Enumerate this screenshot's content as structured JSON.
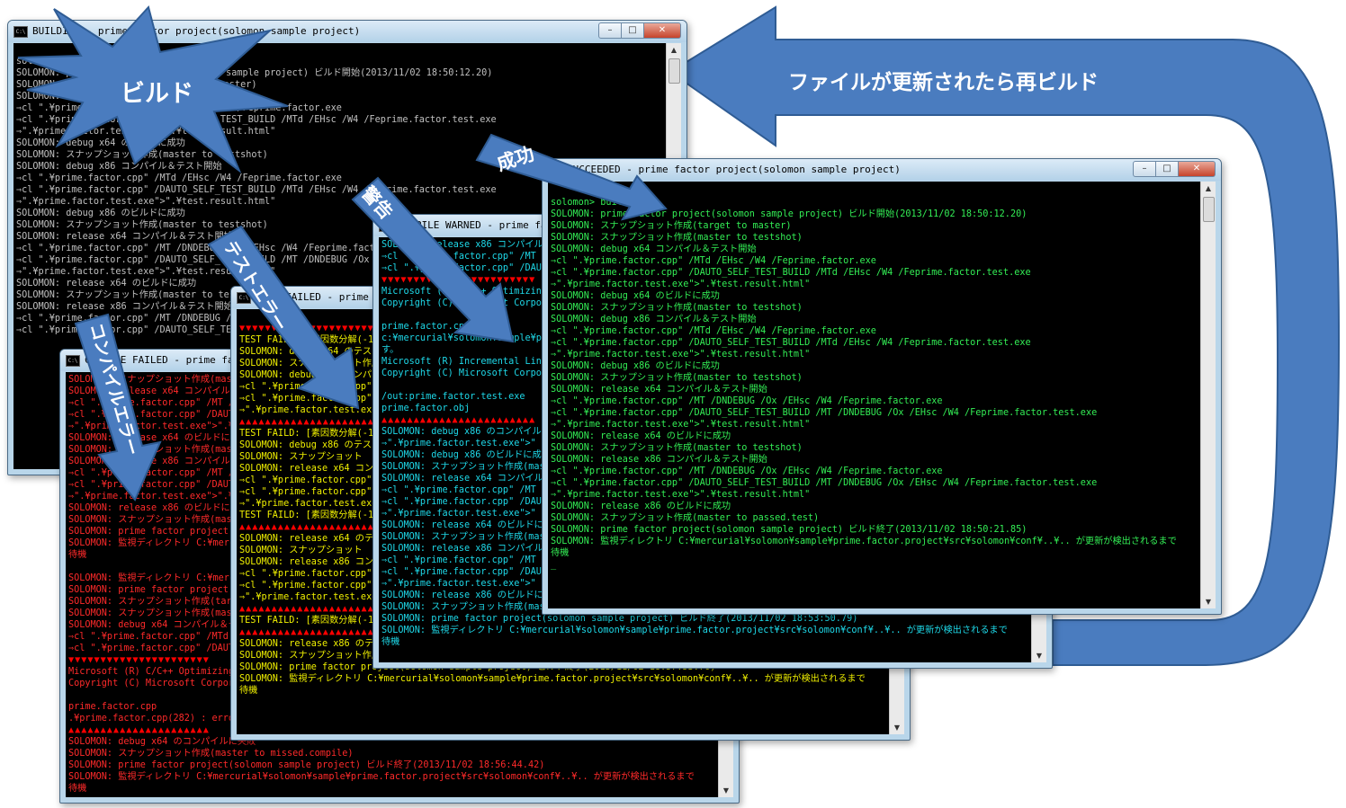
{
  "windows": {
    "building": {
      "title": "BUILDING - prime factor project(solomon sample project)",
      "lines": [
        "solomon> cd \\out",
        "SOLOMON: prime factor project(solomon sample project) ビルド開始(2013/11/02 18:50:12.20)",
        "SOLOMON: スナップショット作成(target to master)",
        "SOLOMON: debug x64 コンパイル＆テスト開始",
        "⇒cl \".¥prime.factor.cpp\" /MTd /EHsc /W4 /Feprime.factor.exe",
        "⇒cl \".¥prime.factor.cpp\" /DAUTO_SELF_TEST_BUILD /MTd /EHsc /W4 /Feprime.factor.test.exe",
        "⇒\".¥prime.factor.test.exe\">\".¥test.result.html\"",
        "SOLOMON: debug x64 のビルドに成功",
        "SOLOMON: スナップショット作成(master to testshot)",
        "SOLOMON: debug x86 コンパイル＆テスト開始",
        "⇒cl \".¥prime.factor.cpp\" /MTd /EHsc /W4 /Feprime.factor.exe",
        "⇒cl \".¥prime.factor.cpp\" /DAUTO_SELF_TEST_BUILD /MTd /EHsc /W4 /Feprime.factor.test.exe",
        "⇒\".¥prime.factor.test.exe\">\".¥test.result.html\"",
        "SOLOMON: debug x86 のビルドに成功",
        "SOLOMON: スナップショット作成(master to testshot)",
        "SOLOMON: release x64 コンパイル＆テスト開始",
        "⇒cl \".¥prime.factor.cpp\" /MT /DNDEBUG /Ox /EHsc /W4 /Feprime.factor.exe",
        "⇒cl \".¥prime.factor.cpp\" /DAUTO_SELF_TEST_BUILD /MT /DNDEBUG /Ox /EHsc /W4",
        "⇒\".¥prime.factor.test.exe\">\".¥test.result.html\"",
        "SOLOMON: release x64 のビルドに成功",
        "SOLOMON: スナップショット作成(master to testshot)",
        "SOLOMON: release x86 コンパイル＆テスト開始",
        "⇒cl \".¥prime.factor.cpp\" /MT /DNDEBUG /Ox /EHsc /W4",
        "⇒cl \".¥prime.factor.cpp\" /DAUTO_SELF_TEST_BUILD /MT"
      ]
    },
    "compile_failed": {
      "title": "COMPILE FAILED - prime factor project(solomon sample project)",
      "lines": [
        "SOLOMON: スナップショット作成(master to testshot)",
        "SOLOMON: release x64 コンパイル＆テスト開始",
        "⇒cl \".¥prime.factor.cpp\" /MT /DNDEBUG /Ox /EHsc /W4",
        "⇒cl \".¥prime.factor.cpp\" /DAUTO_SELF_TEST_BUILD /MT",
        "⇒\".¥prime.factor.test.exe\">\".¥test.result.html\"",
        "SOLOMON: release x64 のビルドに成功",
        "SOLOMON: スナップショット作成(master to testshot)",
        "SOLOMON: release x86 コンパイル＆テスト開始",
        "⇒cl \".¥prime.factor.cpp\" /MT /DNDEBUG /Ox /EHsc /W4",
        "⇒cl \".¥prime.factor.cpp\" /DAUTO_SELF_TEST_BUILD /MT",
        "⇒\".¥prime.factor.test.exe\">\".¥test.result.html\"",
        "SOLOMON: release x86 のビルドに成功",
        "SOLOMON: スナップショット作成(master to testshot)",
        "SOLOMON: prime factor project(solomon sample project)",
        "SOLOMON: 監視ディレクトリ C:¥mercurial¥solomon¥sample",
        "待機",
        "",
        "SOLOMON: 監視ディレクトリ C:¥mercurial¥solomon¥sample",
        "SOLOMON: prime factor project(solomon sample project)",
        "SOLOMON: スナップショット作成(target to master)",
        "SOLOMON: スナップショット作成(master to testshot)",
        "SOLOMON: debug x64 コンパイル＆テスト開始",
        "⇒cl \".¥prime.factor.cpp\" /MTd /EHsc /W4",
        "⇒cl \".¥prime.factor.cpp\" /DAUTO_SELF_TEST_BUILD",
        "▼▼▼▼▼▼▼▼▼▼▼▼▼▼▼▼▼▼▼▼▼▼",
        "Microsoft (R) C/C++ Optimizing Compiler",
        "Copyright (C) Microsoft Corporation",
        "",
        "prime.factor.cpp",
        ".¥prime.factor.cpp(282) : error C2065",
        "▲▲▲▲▲▲▲▲▲▲▲▲▲▲▲▲▲▲▲▲▲▲",
        "SOLOMON: debug x64 のコンパイルに失敗",
        "SOLOMON: スナップショット作成(master to missed.compile)",
        "SOLOMON: prime factor project(solomon sample project) ビルド終了(2013/11/02 18:56:44.42)",
        "SOLOMON: 監視ディレクトリ C:¥mercurial¥solomon¥sample¥prime.factor.project¥src¥solomon¥conf¥..¥.. が更新が検出されるまで",
        "待機"
      ]
    },
    "test_failed": {
      "title": "TEST FAILED - prime factor project(solomon sample project)",
      "lines": [
        "▼▼▼▼▼▼▼▼▼▼▼▼▼▼▼▼▼▼▼▼▼▼",
        "TEST FAILD: [素因数分解(-1)]",
        "SOLOMON: debug x64 のテストに失敗",
        "SOLOMON: スナップショット作成",
        "SOLOMON: debug x86 コンパイル",
        "⇒cl \".¥prime.factor.cpp\"",
        "⇒cl \".¥prime.factor.cpp\"",
        "⇒\".¥prime.factor.test.exe\"",
        "▲▲▲▲▲▲▲▲▲▲▲▲▲▲▲▲▲▲▲▲▲▲",
        "TEST FAILD: [素因数分解(-1)]",
        "SOLOMON: debug x86 のテスト",
        "SOLOMON: スナップショット",
        "SOLOMON: release x64 コン",
        "⇒cl \".¥prime.factor.cpp\"",
        "⇒cl \".¥prime.factor.cpp\"",
        "⇒\".¥prime.factor.test.exe\"",
        "TEST FAILD: [素因数分解(-1)]",
        "▲▲▲▲▲▲▲▲▲▲▲▲▲▲▲▲▲▲▲▲▲▲",
        "SOLOMON: release x64 のテ",
        "SOLOMON: スナップショット",
        "SOLOMON: release x86 コン",
        "⇒cl \".¥prime.factor.cpp\"",
        "⇒cl \".¥prime.factor.cpp\"",
        "⇒\".¥prime.factor.test.exe\"",
        "▲▲▲▲▲▲▲▲▲▲▲▲▲▲▲▲▲▲▲▲▲▲",
        "TEST FAILD: [素因数分解(-1)]",
        "▲▲▲▲▲▲▲▲▲▲▲▲▲▲▲▲▲▲▲▲▲▲",
        "SOLOMON: release x86 のテストに失敗",
        "SOLOMON: スナップショット作成(master to missed.test)",
        "SOLOMON: prime factor project(solomon sample project) ビルド終了(2013/11/02 18:57:53.76)",
        "SOLOMON: 監視ディレクトリ C:¥mercurial¥solomon¥sample¥prime.factor.project¥src¥solomon¥conf¥..¥.. が更新が検出されるまで",
        "待機"
      ]
    },
    "compile_warned": {
      "title": "COMPILE WARNED - prime factor project(solomon sample project)",
      "lines": [
        "SOLOMON: release x86 コンパイル＆テスト開始",
        "⇒cl \".¥prime.factor.cpp\" /MT",
        "⇒cl \".¥prime.factor.cpp\" /DAUTO_SELF_TEST_BUILD",
        "▼▼▼▼▼▼▼▼▼▼▼▼▼▼▼▼▼▼▼▼▼▼▼▼",
        "Microsoft (R) C/C++ Optimizing Compiler",
        "Copyright (C) Microsoft Corporation",
        "",
        "prime.factor.cpp",
        "c:¥mercurial¥solomon¥sample¥prime.factor",
        "す。",
        "Microsoft (R) Incremental Linker",
        "Copyright (C) Microsoft Corporation",
        "",
        "/out:prime.factor.test.exe",
        "prime.factor.obj",
        "▲▲▲▲▲▲▲▲▲▲▲▲▲▲▲▲▲▲▲▲▲▲▲▲",
        "SOLOMON: debug x86 のコンパイル",
        "⇒\".¥prime.factor.test.exe\">\"",
        "SOLOMON: debug x86 のビルドに成功",
        "SOLOMON: スナップショット作成(master",
        "SOLOMON: release x64 コンパイル",
        "⇒cl \".¥prime.factor.cpp\" /MT",
        "⇒cl \".¥prime.factor.cpp\" /DAU",
        "⇒\".¥prime.factor.test.exe\">\"",
        "SOLOMON: release x64 のビルドに成功",
        "SOLOMON: スナップショット作成(master",
        "SOLOMON: release x86 コンパイル",
        "⇒cl \".¥prime.factor.cpp\" /MT",
        "⇒cl \".¥prime.factor.cpp\" /DAU",
        "⇒\".¥prime.factor.test.exe\">\"",
        "SOLOMON: release x86 のビルドに成功",
        "SOLOMON: スナップショット作成(master to passed.test)",
        "SOLOMON: prime factor project(solomon sample project) ビルド終了(2013/11/02 18:53:50.79)",
        "SOLOMON: 監視ディレクトリ C:¥mercurial¥solomon¥sample¥prime.factor.project¥src¥solomon¥conf¥..¥.. が更新が検出されるまで",
        "待機"
      ]
    },
    "succeeded": {
      "title": "SUCCEEDED - prime factor project(solomon sample project)",
      "lines": [
        "solomon> build.cmd",
        "SOLOMON: prime factor project(solomon sample project) ビルド開始(2013/11/02 18:50:12.20)",
        "SOLOMON: スナップショット作成(target to master)",
        "SOLOMON: スナップショット作成(master to testshot)",
        "SOLOMON: debug x64 コンパイル＆テスト開始",
        "⇒cl \".¥prime.factor.cpp\" /MTd /EHsc /W4 /Feprime.factor.exe",
        "⇒cl \".¥prime.factor.cpp\" /DAUTO_SELF_TEST_BUILD /MTd /EHsc /W4 /Feprime.factor.test.exe",
        "⇒\".¥prime.factor.test.exe\">\".¥test.result.html\"",
        "SOLOMON: debug x64 のビルドに成功",
        "SOLOMON: スナップショット作成(master to testshot)",
        "SOLOMON: debug x86 コンパイル＆テスト開始",
        "⇒cl \".¥prime.factor.cpp\" /MTd /EHsc /W4 /Feprime.factor.exe",
        "⇒cl \".¥prime.factor.cpp\" /DAUTO_SELF_TEST_BUILD /MTd /EHsc /W4 /Feprime.factor.test.exe",
        "⇒\".¥prime.factor.test.exe\">\".¥test.result.html\"",
        "SOLOMON: debug x86 のビルドに成功",
        "SOLOMON: スナップショット作成(master to testshot)",
        "SOLOMON: release x64 コンパイル＆テスト開始",
        "⇒cl \".¥prime.factor.cpp\" /MT /DNDEBUG /Ox /EHsc /W4 /Feprime.factor.exe",
        "⇒cl \".¥prime.factor.cpp\" /DAUTO_SELF_TEST_BUILD /MT /DNDEBUG /Ox /EHsc /W4 /Feprime.factor.test.exe",
        "⇒\".¥prime.factor.test.exe\">\".¥test.result.html\"",
        "SOLOMON: release x64 のビルドに成功",
        "SOLOMON: スナップショット作成(master to testshot)",
        "SOLOMON: release x86 コンパイル＆テスト開始",
        "⇒cl \".¥prime.factor.cpp\" /MT /DNDEBUG /Ox /EHsc /W4 /Feprime.factor.exe",
        "⇒cl \".¥prime.factor.cpp\" /DAUTO_SELF_TEST_BUILD /MT /DNDEBUG /Ox /EHsc /W4 /Feprime.factor.test.exe",
        "⇒\".¥prime.factor.test.exe\">\".¥test.result.html\"",
        "SOLOMON: release x86 のビルドに成功",
        "SOLOMON: スナップショット作成(master to passed.test)",
        "SOLOMON: prime factor project(solomon sample project) ビルド終了(2013/11/02 18:50:21.85)",
        "SOLOMON: 監視ディレクトリ C:¥mercurial¥solomon¥sample¥prime.factor.project¥src¥solomon¥conf¥..¥.. が更新が検出されるまで",
        "待機",
        "_"
      ]
    }
  },
  "callouts": {
    "build": "ビルド",
    "success": "成功",
    "warning": "警告",
    "test_error": "テストエラー",
    "compile_error": "コンパイルエラー",
    "rebuild": "ファイルが更新されたら再ビルド"
  },
  "window_controls": {
    "minimize": "–",
    "maximize": "□",
    "close": "✕"
  },
  "colors": {
    "arrow_blue": "#4a7cbf",
    "arrow_border": "#2f5c94",
    "succeeded_text": "#33ee55",
    "warned_text": "#1ed8e8",
    "test_failed_text": "#f0f000",
    "compile_failed_text": "#ff2a2a",
    "building_text": "#c0c0c0"
  }
}
